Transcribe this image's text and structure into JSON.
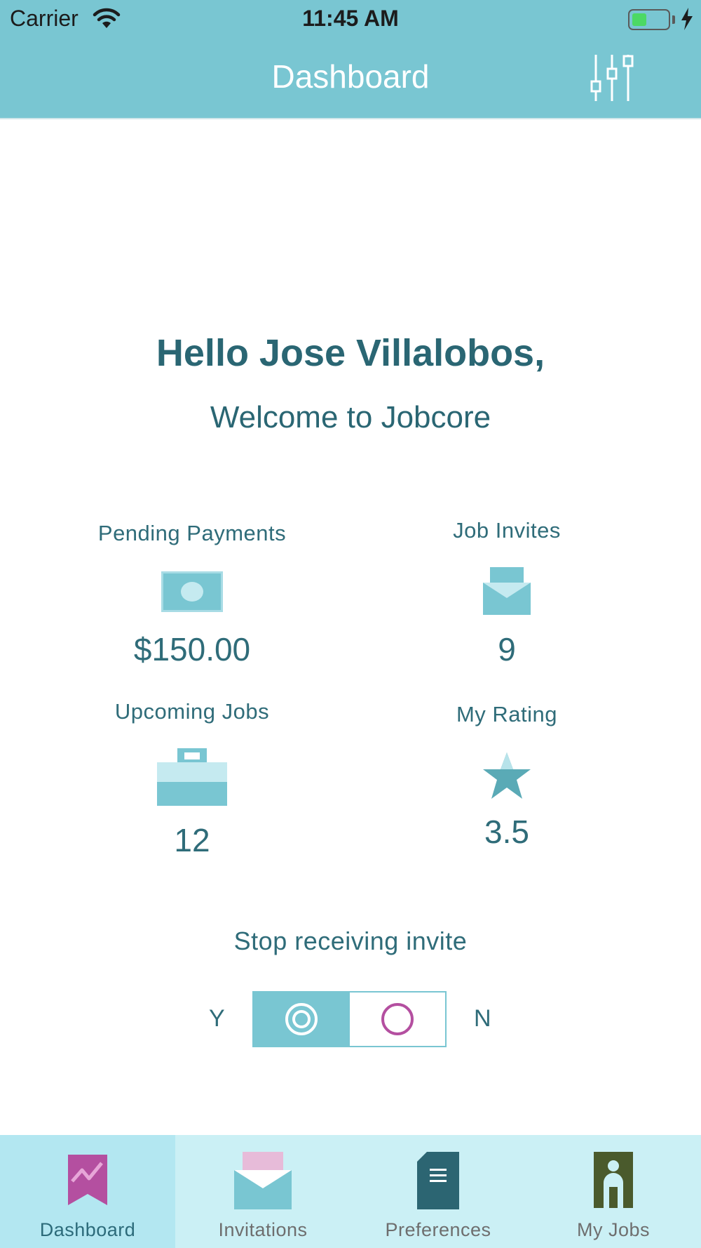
{
  "status_bar": {
    "carrier": "Carrier",
    "time": "11:45 AM"
  },
  "header": {
    "title": "Dashboard",
    "filter_icon": "sliders-icon"
  },
  "greeting": {
    "hello": "Hello Jose Villalobos,",
    "welcome": "Welcome to Jobcore"
  },
  "stats": {
    "pending_payments": {
      "label": "Pending Payments",
      "value": "$150.00",
      "icon": "money-icon"
    },
    "job_invites": {
      "label": "Job Invites",
      "value": "9",
      "icon": "envelope-icon"
    },
    "upcoming_jobs": {
      "label": "Upcoming Jobs",
      "value": "12",
      "icon": "briefcase-icon"
    },
    "my_rating": {
      "label": "My Rating",
      "value": "3.5",
      "icon": "star-icon"
    }
  },
  "invite_toggle": {
    "label": "Stop receiving invite",
    "yes_label": "Y",
    "no_label": "N",
    "selected": "Y"
  },
  "tabbar": {
    "tabs": [
      {
        "label": "Dashboard",
        "icon": "dashboard-icon",
        "active": true
      },
      {
        "label": "Invitations",
        "icon": "envelope-icon",
        "active": false
      },
      {
        "label": "Preferences",
        "icon": "document-icon",
        "active": false
      },
      {
        "label": "My Jobs",
        "icon": "person-icon",
        "active": false
      }
    ]
  },
  "colors": {
    "header": "#79c6d2",
    "primary_text": "#2a6673",
    "accent": "#b44fa0",
    "tabbar": "#cbf0f5",
    "tab_active": "#b3e7f1"
  }
}
